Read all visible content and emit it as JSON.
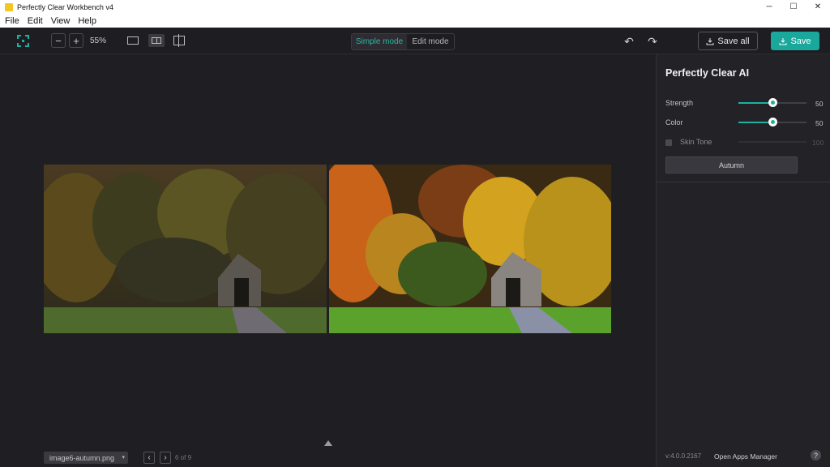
{
  "window": {
    "title": "Perfectly Clear Workbench v4",
    "controls": [
      "─",
      "☐",
      "✕"
    ]
  },
  "menu": [
    "File",
    "Edit",
    "View",
    "Help"
  ],
  "toolbar": {
    "zoom_out": "−",
    "zoom_in": "+",
    "zoom_level": "55%",
    "mode_simple": "Simple mode",
    "mode_edit": "Edit mode",
    "active_mode": "Simple mode",
    "undo": "↶",
    "redo": "↷",
    "save_all": "Save all",
    "save": "Save"
  },
  "panel": {
    "title": "Perfectly Clear AI",
    "strength": {
      "label": "Strength",
      "value": "50",
      "level": 0.5
    },
    "color": {
      "label": "Color",
      "value": "50",
      "level": 0.5
    },
    "skin_tone": {
      "label": "Skin Tone",
      "value": "100",
      "checked": false
    },
    "preset_button": "Autumn",
    "version": "v:4.0.0.2167",
    "apps_manager": "Open Apps Manager",
    "help": "?"
  },
  "footer": {
    "filename": "image6-autumn.png",
    "prev": "‹",
    "next": "›",
    "page_count": "6 of 9"
  },
  "colors": {
    "accent": "#19a89b",
    "background": "#1f1f23",
    "panel": "#232327"
  }
}
